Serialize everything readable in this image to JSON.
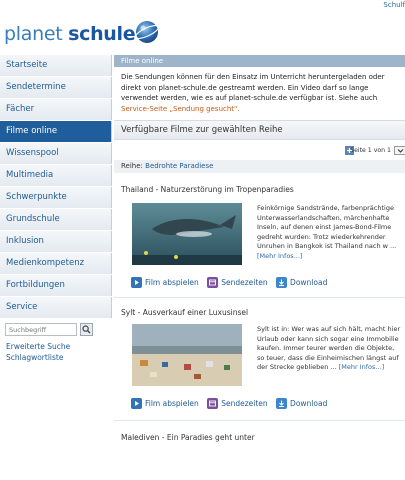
{
  "header": {
    "top_link": "Schulf",
    "logo_part1": "planet ",
    "logo_part2": "schule"
  },
  "sidebar": {
    "items": [
      {
        "label": "Startseite",
        "active": false
      },
      {
        "label": "Sendetermine",
        "active": false
      },
      {
        "label": "Fächer",
        "active": false
      },
      {
        "label": "Filme online",
        "active": true
      },
      {
        "label": "Wissenspool",
        "active": false
      },
      {
        "label": "Multimedia",
        "active": false
      },
      {
        "label": "Schwerpunkte",
        "active": false
      },
      {
        "label": "Grundschule",
        "active": false
      },
      {
        "label": "Inklusion",
        "active": false
      },
      {
        "label": "Medienkompetenz",
        "active": false
      },
      {
        "label": "Fortbildungen",
        "active": false
      },
      {
        "label": "Service",
        "active": false
      }
    ],
    "search_placeholder": "Suchbegriff",
    "links": [
      "Erweiterte Suche",
      "Schlagwortliste"
    ]
  },
  "main": {
    "breadcrumb": "Filme online",
    "intro_text": "Die Sendungen können für den Einsatz im Unterricht heruntergeladen oder direkt von planet-schule.de gestreamt werden. Ein Video darf so lange verwendet werden, wie es auf planet-schule.de verfügbar ist. Siehe auch",
    "intro_link": "Service-Seite „Sendung gesucht\".",
    "section_title": "Verfügbare Filme zur gewählten Reihe",
    "pager_text": "Seite 1 von 1",
    "reihe_label": "Reihe:",
    "reihe_value": "Bedrohte Paradiese",
    "films": [
      {
        "title": "Thailand - Naturzerstörung im Tropenparadies",
        "description": "Feinkörnige Sandstrände, farbenprächtige Unterwasserlandschaften, märchenhafte Inseln, auf denen einst James-Bond-Filme gedreht wurden: Trotz wiederkehrender Unruhen in Bangkok ist Thailand nach w ...",
        "more": "[Mehr Infos...]"
      },
      {
        "title": "Sylt - Ausverkauf einer Luxusinsel",
        "description": "Sylt ist in: Wer was auf sich hält, macht hier Urlaub oder kann sich sogar eine Immobilie kaufen. Immer teurer werden die Objekte, so teuer, dass die Einheimischen längst auf der Strecke geblieben ...",
        "more": "[Mehr Infos...]"
      },
      {
        "title": "Malediven - Ein Paradies geht unter"
      }
    ],
    "actions": {
      "play": "Film abspielen",
      "times": "Sendezeiten",
      "download": "Download"
    }
  },
  "colors": {
    "brand_blue": "#1f5d9b",
    "link_blue": "#1f5b93",
    "link_orange": "#c65a12",
    "breadcrumb_bar": "#9db4cb"
  }
}
